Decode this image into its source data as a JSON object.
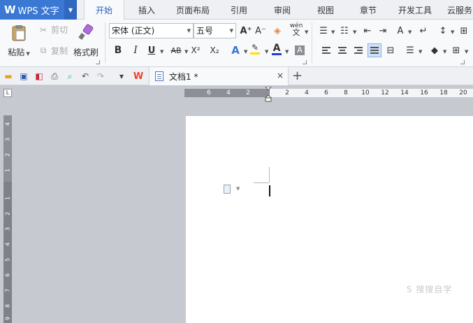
{
  "app": {
    "logo": "W",
    "title": "WPS 文字"
  },
  "menu_tabs": [
    "开始",
    "插入",
    "页面布局",
    "引用",
    "审阅",
    "视图",
    "章节",
    "开发工具",
    "云服务"
  ],
  "active_tab": "开始",
  "clipboard": {
    "paste": "粘贴",
    "cut": "剪切",
    "copy": "复制",
    "format_painter": "格式刷"
  },
  "font": {
    "name": "宋体 (正文)",
    "size": "五号"
  },
  "format_buttons": {
    "bold": "B",
    "italic": "I",
    "underline": "U",
    "strike": "AB",
    "superscript": "X²",
    "subscript": "X₂",
    "grow": "A⁺",
    "shrink": "A⁻",
    "pinyin": "wén"
  },
  "colors": {
    "accent": "#3a78d4",
    "font_color": "#1f3fd8",
    "highlight": "#ffe000",
    "ruler_dark": "#8c8f96"
  },
  "document_tab": {
    "title": "文档1 *",
    "close": "×",
    "new": "+"
  },
  "h_ruler_labels": [
    "6",
    "4",
    "2",
    "2",
    "4",
    "6",
    "8",
    "10",
    "12",
    "14",
    "16",
    "18",
    "20"
  ],
  "v_ruler_labels": [
    "4",
    "3",
    "2",
    "1",
    "1",
    "2",
    "3",
    "4",
    "5",
    "6",
    "7",
    "8",
    "9"
  ],
  "watermark": "S 搜搜自学"
}
